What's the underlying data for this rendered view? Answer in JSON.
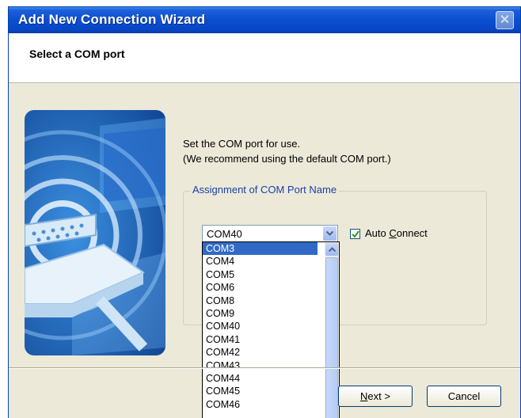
{
  "window": {
    "title": "Add New Connection Wizard",
    "close_glyph": "✕"
  },
  "header": {
    "title": "Select a COM port"
  },
  "description": {
    "line1": "Set the COM port for use.",
    "line2": "(We recommend using the default COM port.)"
  },
  "group": {
    "label": "Assignment of COM Port Name"
  },
  "combo": {
    "value": "COM40",
    "options": [
      "COM3",
      "COM4",
      "COM5",
      "COM6",
      "COM8",
      "COM9",
      "COM40",
      "COM41",
      "COM42",
      "COM43",
      "COM44",
      "COM45",
      "COM46"
    ],
    "highlighted_option": "COM3"
  },
  "auto_connect": {
    "label_prefix": "Auto ",
    "label_accel": "C",
    "label_rest": "onnect",
    "checked": true
  },
  "buttons": {
    "next_accel": "N",
    "next_rest": "ext >",
    "cancel": "Cancel"
  },
  "colors": {
    "title_bar": "#0a4fd0",
    "selection": "#316ac5",
    "dialog_bg": "#ece9d8"
  }
}
